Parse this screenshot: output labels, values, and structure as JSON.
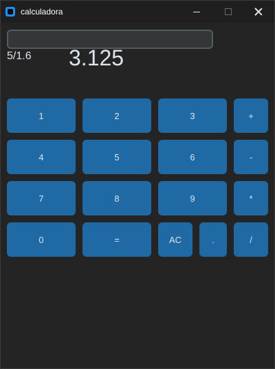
{
  "window": {
    "title": "calculadora",
    "icon": "app-icon",
    "controls": [
      "minimize-icon",
      "maximize-icon",
      "close-icon"
    ]
  },
  "display": {
    "entry_value": "",
    "expression": "5/1.6",
    "result": "3.125"
  },
  "keypad": {
    "k1": "1",
    "k2": "2",
    "k3": "3",
    "plus": "+",
    "k4": "4",
    "k5": "5",
    "k6": "6",
    "minus": "-",
    "k7": "7",
    "k8": "8",
    "k9": "9",
    "multiply": "*",
    "k0": "0",
    "equals": "=",
    "clear": "AC",
    "dot": ".",
    "divide": "/"
  },
  "colors": {
    "background": "#242424",
    "button": "#1f6aa5",
    "text": "#dce4ee",
    "entry_bg": "#343638",
    "entry_border": "#565b5e"
  }
}
